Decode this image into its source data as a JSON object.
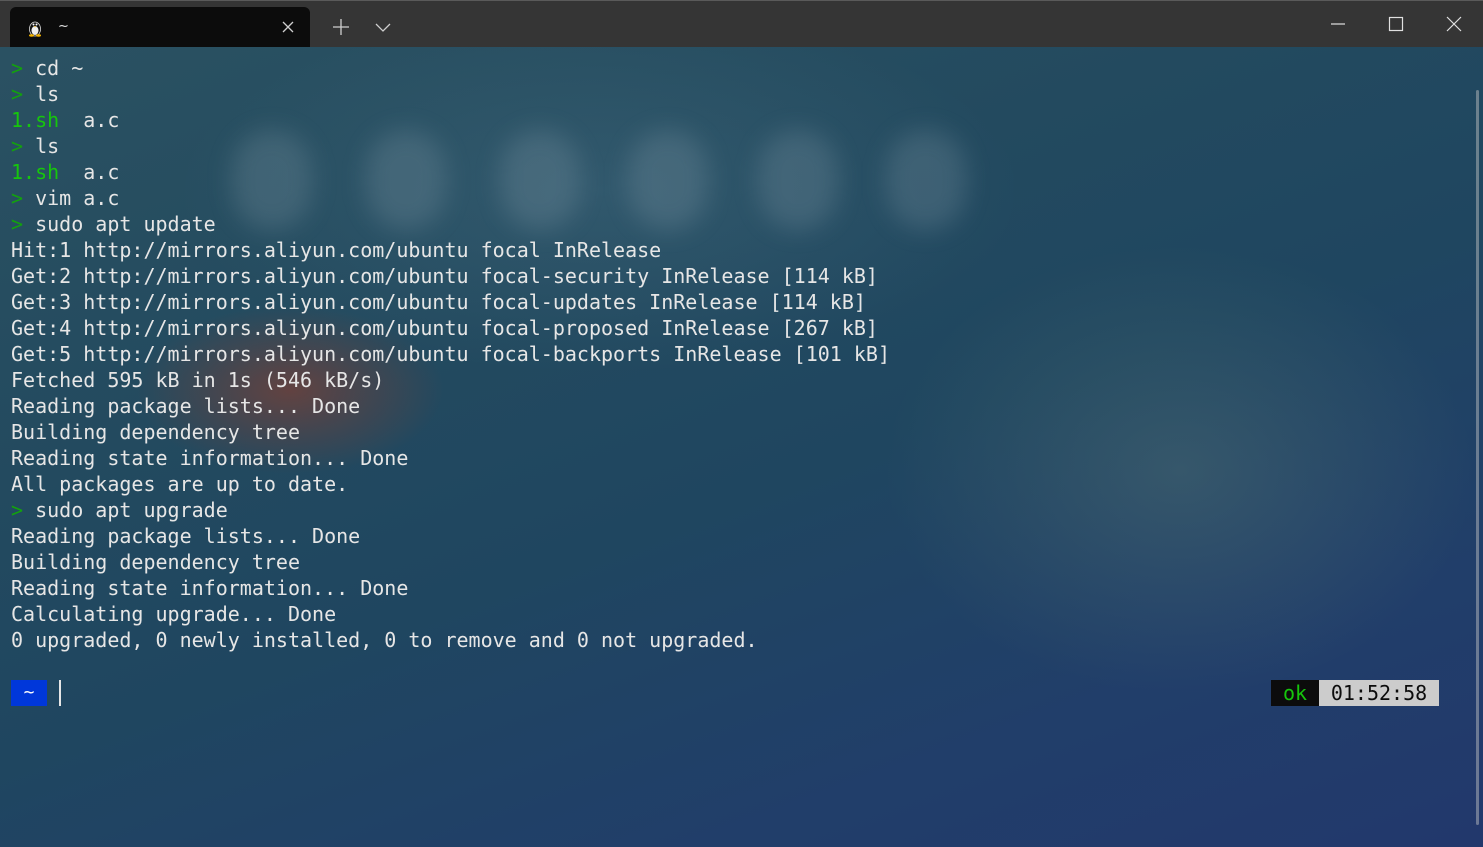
{
  "window": {
    "tab_title": "~",
    "tab_icon": "linux-penguin-icon",
    "new_tab_icon": "plus-icon",
    "dropdown_icon": "chevron-down-icon",
    "controls": [
      "minimize-icon",
      "maximize-icon",
      "close-icon"
    ]
  },
  "colors": {
    "prompt_green": "#13a10e",
    "file_green": "#16c60c",
    "dir_badge_blue": "#0037da",
    "status_time_bg": "#cccccc"
  },
  "terminal": {
    "lines": [
      {
        "prompt": "> ",
        "text": "cd ~"
      },
      {
        "prompt": "> ",
        "text": "ls"
      },
      {
        "green": "1.sh",
        "text": "  a.c"
      },
      {
        "prompt": "> ",
        "text": "ls"
      },
      {
        "green": "1.sh",
        "text": "  a.c"
      },
      {
        "prompt": "> ",
        "text": "vim a.c"
      },
      {
        "prompt": "> ",
        "text": "sudo apt update"
      },
      {
        "text": "Hit:1 http://mirrors.aliyun.com/ubuntu focal InRelease"
      },
      {
        "text": "Get:2 http://mirrors.aliyun.com/ubuntu focal-security InRelease [114 kB]"
      },
      {
        "text": "Get:3 http://mirrors.aliyun.com/ubuntu focal-updates InRelease [114 kB]"
      },
      {
        "text": "Get:4 http://mirrors.aliyun.com/ubuntu focal-proposed InRelease [267 kB]"
      },
      {
        "text": "Get:5 http://mirrors.aliyun.com/ubuntu focal-backports InRelease [101 kB]"
      },
      {
        "text": "Fetched 595 kB in 1s (546 kB/s)"
      },
      {
        "text": "Reading package lists... Done"
      },
      {
        "text": "Building dependency tree"
      },
      {
        "text": "Reading state information... Done"
      },
      {
        "text": "All packages are up to date."
      },
      {
        "prompt": "> ",
        "text": "sudo apt upgrade"
      },
      {
        "text": "Reading package lists... Done"
      },
      {
        "text": "Building dependency tree"
      },
      {
        "text": "Reading state information... Done"
      },
      {
        "text": "Calculating upgrade... Done"
      },
      {
        "text": "0 upgraded, 0 newly installed, 0 to remove and 0 not upgraded."
      }
    ],
    "current_dir": "~",
    "status_ok": "ok",
    "status_time": "01:52:58"
  }
}
